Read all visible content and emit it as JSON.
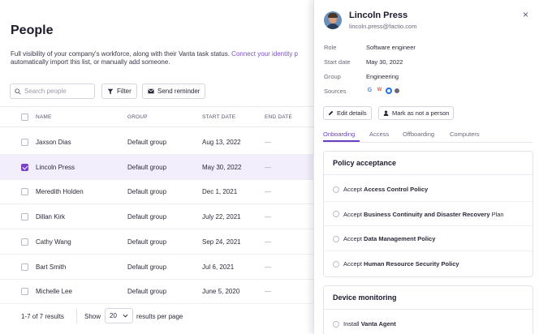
{
  "page": {
    "title": "People",
    "description_prefix": "Full visibility of your company's workforce, along with their Vanta task status.",
    "description_link": "Connect your identity p",
    "description_suffix": "automatically import this list, or manually add someone.",
    "search_placeholder": "Search people",
    "filter_label": "Filter",
    "send_reminder_label": "Send reminder"
  },
  "table": {
    "columns": [
      "NAME",
      "GROUP",
      "START DATE",
      "END DATE"
    ],
    "rows": [
      {
        "name": "Jaxson Dias",
        "group": "Default group",
        "start": "Aug 13, 2022",
        "end": "—",
        "checked": false
      },
      {
        "name": "Lincoln Press",
        "group": "Default group",
        "start": "May 30, 2022",
        "end": "—",
        "checked": true
      },
      {
        "name": "Meredith Holden",
        "group": "Default group",
        "start": "Dec 1, 2021",
        "end": "—",
        "checked": false
      },
      {
        "name": "Dillan Kirk",
        "group": "Default group",
        "start": "July 22, 2021",
        "end": "—",
        "checked": false
      },
      {
        "name": "Cathy Wang",
        "group": "Default group",
        "start": "Sep 24, 2021",
        "end": "—",
        "checked": false
      },
      {
        "name": "Bart Smith",
        "group": "Default group",
        "start": "Jul 6, 2021",
        "end": "—",
        "checked": false
      },
      {
        "name": "Michelle Lee",
        "group": "Default group",
        "start": "June 5, 2020",
        "end": "—",
        "checked": false
      }
    ]
  },
  "footer": {
    "count": "1-7 of 7 results",
    "show_label": "Show",
    "per_page_value": "20",
    "per_page_label": "results per page"
  },
  "panel": {
    "name": "Lincoln Press",
    "email": "lincoln.press@factio.com",
    "close_glyph": "×",
    "meta": [
      {
        "label": "Role",
        "value": "Software engineer"
      },
      {
        "label": "Start date",
        "value": "May 30, 2022"
      },
      {
        "label": "Group",
        "value": "Engineering"
      },
      {
        "label": "Sources",
        "value": ""
      }
    ],
    "sources": [
      "google-icon",
      "gusto-icon",
      "okta-icon",
      "info-icon"
    ],
    "edit_label": "Edit details",
    "mark_label": "Mark as not a person",
    "tabs": [
      "Onboarding",
      "Access",
      "Offboarding",
      "Computers"
    ],
    "active_tab": "Onboarding",
    "policy_card": {
      "title": "Policy acceptance",
      "items": [
        {
          "prefix": "Accept",
          "bold": "Access Control Policy",
          "suffix": ""
        },
        {
          "prefix": "Accept",
          "bold": "Business Continuity and Disaster Recovery",
          "suffix": "Plan"
        },
        {
          "prefix": "Accept",
          "bold": "Data Management Policy",
          "suffix": ""
        },
        {
          "prefix": "Accept",
          "bold": "Human Resource Security Policy",
          "suffix": ""
        }
      ]
    },
    "device_card": {
      "title": "Device monitoring",
      "items": [
        {
          "prefix": "Install",
          "bold": "Vanta Agent",
          "suffix": ""
        }
      ]
    }
  },
  "colors": {
    "accent": "#6b3fc2",
    "selected_row": "#f3eefb",
    "link": "#7b4fc9"
  }
}
